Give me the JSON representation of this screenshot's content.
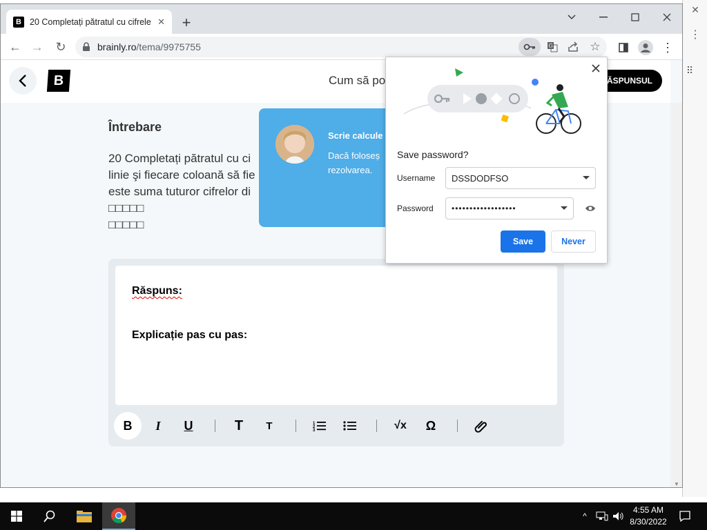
{
  "browser": {
    "tab_title": "20 Completați pătratul cu cifrele",
    "tab_close": "✕",
    "new_tab": "+",
    "url_domain": "brainly.ro",
    "url_path": "/tema/9975755"
  },
  "page": {
    "header_title": "Cum să po",
    "answer_button": "RĂSPUNSUL",
    "question_heading": "Întrebare",
    "question_lines": [
      "20 Completați pătratul cu ci",
      "linie şi fiecare coloană să fie",
      "este suma tuturor cifrelor di",
      "□□□□□",
      "□□□□□",
      "□□□□□"
    ],
    "answer_label": "Răspuns:",
    "explain_label": "Explicație pas cu pas:"
  },
  "tooltip": {
    "title": "Scrie calcule",
    "body": "Dacă foloseș rezolvarea."
  },
  "password_popup": {
    "title": "Save password?",
    "username_label": "Username",
    "username_value": "DSSDODFSO",
    "password_label": "Password",
    "password_value": "••••••••••••••••••",
    "save_button": "Save",
    "never_button": "Never"
  },
  "taskbar": {
    "time": "4:55 AM",
    "date": "8/30/2022"
  },
  "colors": {
    "save_blue": "#1a73e8",
    "tooltip_blue": "#4fade7"
  }
}
